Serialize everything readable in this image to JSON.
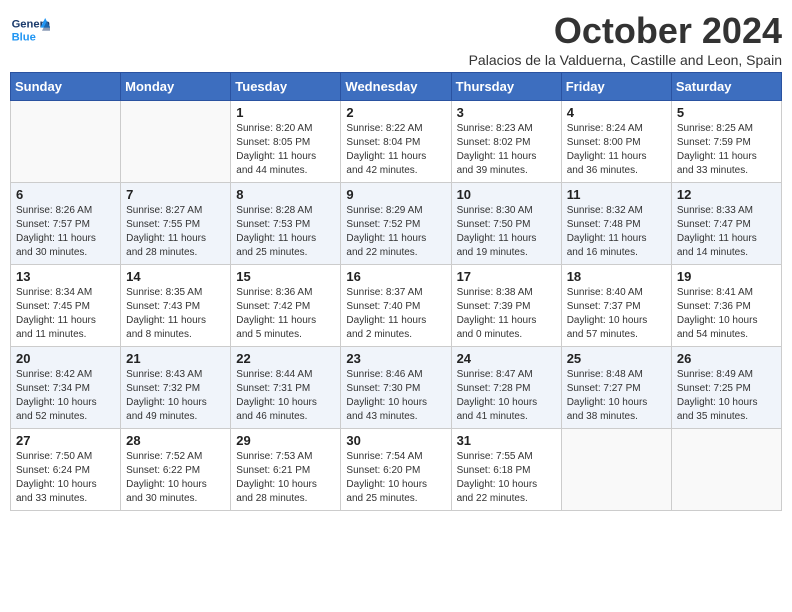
{
  "header": {
    "logo_general": "General",
    "logo_blue": "Blue",
    "title": "October 2024",
    "subtitle": "Palacios de la Valduerna, Castille and Leon, Spain"
  },
  "weekdays": [
    "Sunday",
    "Monday",
    "Tuesday",
    "Wednesday",
    "Thursday",
    "Friday",
    "Saturday"
  ],
  "weeks": [
    [
      {
        "day": "",
        "info": ""
      },
      {
        "day": "",
        "info": ""
      },
      {
        "day": "1",
        "info": "Sunrise: 8:20 AM\nSunset: 8:05 PM\nDaylight: 11 hours and 44 minutes."
      },
      {
        "day": "2",
        "info": "Sunrise: 8:22 AM\nSunset: 8:04 PM\nDaylight: 11 hours and 42 minutes."
      },
      {
        "day": "3",
        "info": "Sunrise: 8:23 AM\nSunset: 8:02 PM\nDaylight: 11 hours and 39 minutes."
      },
      {
        "day": "4",
        "info": "Sunrise: 8:24 AM\nSunset: 8:00 PM\nDaylight: 11 hours and 36 minutes."
      },
      {
        "day": "5",
        "info": "Sunrise: 8:25 AM\nSunset: 7:59 PM\nDaylight: 11 hours and 33 minutes."
      }
    ],
    [
      {
        "day": "6",
        "info": "Sunrise: 8:26 AM\nSunset: 7:57 PM\nDaylight: 11 hours and 30 minutes."
      },
      {
        "day": "7",
        "info": "Sunrise: 8:27 AM\nSunset: 7:55 PM\nDaylight: 11 hours and 28 minutes."
      },
      {
        "day": "8",
        "info": "Sunrise: 8:28 AM\nSunset: 7:53 PM\nDaylight: 11 hours and 25 minutes."
      },
      {
        "day": "9",
        "info": "Sunrise: 8:29 AM\nSunset: 7:52 PM\nDaylight: 11 hours and 22 minutes."
      },
      {
        "day": "10",
        "info": "Sunrise: 8:30 AM\nSunset: 7:50 PM\nDaylight: 11 hours and 19 minutes."
      },
      {
        "day": "11",
        "info": "Sunrise: 8:32 AM\nSunset: 7:48 PM\nDaylight: 11 hours and 16 minutes."
      },
      {
        "day": "12",
        "info": "Sunrise: 8:33 AM\nSunset: 7:47 PM\nDaylight: 11 hours and 14 minutes."
      }
    ],
    [
      {
        "day": "13",
        "info": "Sunrise: 8:34 AM\nSunset: 7:45 PM\nDaylight: 11 hours and 11 minutes."
      },
      {
        "day": "14",
        "info": "Sunrise: 8:35 AM\nSunset: 7:43 PM\nDaylight: 11 hours and 8 minutes."
      },
      {
        "day": "15",
        "info": "Sunrise: 8:36 AM\nSunset: 7:42 PM\nDaylight: 11 hours and 5 minutes."
      },
      {
        "day": "16",
        "info": "Sunrise: 8:37 AM\nSunset: 7:40 PM\nDaylight: 11 hours and 2 minutes."
      },
      {
        "day": "17",
        "info": "Sunrise: 8:38 AM\nSunset: 7:39 PM\nDaylight: 11 hours and 0 minutes."
      },
      {
        "day": "18",
        "info": "Sunrise: 8:40 AM\nSunset: 7:37 PM\nDaylight: 10 hours and 57 minutes."
      },
      {
        "day": "19",
        "info": "Sunrise: 8:41 AM\nSunset: 7:36 PM\nDaylight: 10 hours and 54 minutes."
      }
    ],
    [
      {
        "day": "20",
        "info": "Sunrise: 8:42 AM\nSunset: 7:34 PM\nDaylight: 10 hours and 52 minutes."
      },
      {
        "day": "21",
        "info": "Sunrise: 8:43 AM\nSunset: 7:32 PM\nDaylight: 10 hours and 49 minutes."
      },
      {
        "day": "22",
        "info": "Sunrise: 8:44 AM\nSunset: 7:31 PM\nDaylight: 10 hours and 46 minutes."
      },
      {
        "day": "23",
        "info": "Sunrise: 8:46 AM\nSunset: 7:30 PM\nDaylight: 10 hours and 43 minutes."
      },
      {
        "day": "24",
        "info": "Sunrise: 8:47 AM\nSunset: 7:28 PM\nDaylight: 10 hours and 41 minutes."
      },
      {
        "day": "25",
        "info": "Sunrise: 8:48 AM\nSunset: 7:27 PM\nDaylight: 10 hours and 38 minutes."
      },
      {
        "day": "26",
        "info": "Sunrise: 8:49 AM\nSunset: 7:25 PM\nDaylight: 10 hours and 35 minutes."
      }
    ],
    [
      {
        "day": "27",
        "info": "Sunrise: 7:50 AM\nSunset: 6:24 PM\nDaylight: 10 hours and 33 minutes."
      },
      {
        "day": "28",
        "info": "Sunrise: 7:52 AM\nSunset: 6:22 PM\nDaylight: 10 hours and 30 minutes."
      },
      {
        "day": "29",
        "info": "Sunrise: 7:53 AM\nSunset: 6:21 PM\nDaylight: 10 hours and 28 minutes."
      },
      {
        "day": "30",
        "info": "Sunrise: 7:54 AM\nSunset: 6:20 PM\nDaylight: 10 hours and 25 minutes."
      },
      {
        "day": "31",
        "info": "Sunrise: 7:55 AM\nSunset: 6:18 PM\nDaylight: 10 hours and 22 minutes."
      },
      {
        "day": "",
        "info": ""
      },
      {
        "day": "",
        "info": ""
      }
    ]
  ]
}
